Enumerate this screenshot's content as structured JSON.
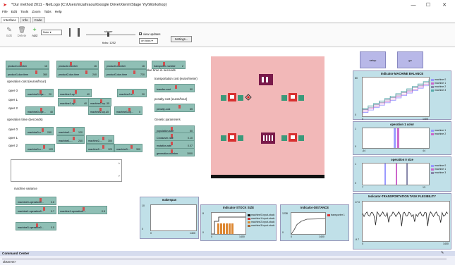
{
  "window": {
    "title": "*Our method 2011 - NetLogo {C:\\Users\\mzahraoui\\Google Drive\\Xterm\\Stage Yiy\\Workshop}",
    "min": "—",
    "max": "☐",
    "close": "✕"
  },
  "menu": [
    "File",
    "Edit",
    "Tools",
    "Zoom",
    "Tabs",
    "Help"
  ],
  "tabs": [
    "Interface",
    "Info",
    "Code"
  ],
  "toolbar": {
    "edit": "Edit",
    "delete": "Delete",
    "add": "Add",
    "widget_select": "Note",
    "speed_label": "slower",
    "ticks": "ticks: 1252",
    "view_updates": "view updates",
    "update_mode": "on ticks",
    "settings": "Settings..."
  },
  "left_sliders": {
    "row1": [
      {
        "name": "product1-number",
        "val": "16"
      },
      {
        "name": "product2-number",
        "val": "16"
      },
      {
        "name": "product3-number",
        "val": "16"
      },
      {
        "name": "transporter-number",
        "val": "2"
      }
    ],
    "row2": [
      {
        "name": "product1-due-time",
        "val": "360"
      },
      {
        "name": "product2-due-time",
        "val": "240"
      },
      {
        "name": "product3-due-time",
        "val": "720"
      }
    ]
  },
  "due_time_label": "due time in seconds",
  "op_cost": {
    "title": "operation cost (euros/hour)",
    "rows": [
      "oper 0",
      "oper 1",
      "oper 2"
    ],
    "s": [
      {
        "name": "machine0-ope...",
        "val": "20"
      },
      {
        "name": "machine1-op...",
        "val": "40"
      },
      {
        "name": "machine3-o...",
        "val": "20"
      },
      {
        "name": "machine1-op...",
        "val": "40"
      },
      {
        "name": "machine2-op...",
        "val": "35"
      },
      {
        "name": "machine0-ope...",
        "val": "40"
      },
      {
        "name": "machine2-op...",
        "val": "45"
      },
      {
        "name": "machine3-op...",
        "val": "0"
      }
    ]
  },
  "op_time": {
    "title": "operation time (seconds)",
    "rows": [
      "oper 0",
      "oper 1",
      "oper 2"
    ],
    "s": [
      {
        "name": "machine0-o...",
        "val": "240"
      },
      {
        "name": "machine1-...",
        "val": "120"
      },
      {
        "name": "machine1-...",
        "val": "240"
      },
      {
        "name": "machine2-...",
        "val": "300"
      },
      {
        "name": "machine0-o...",
        "val": "120"
      },
      {
        "name": "machine2-...",
        "val": "120"
      },
      {
        "name": "machine3-...",
        "val": "300"
      }
    ]
  },
  "transport": {
    "title": "transportation cost (euros/meter)",
    "s": {
      "name": "transfer-cost",
      "val": "50"
    }
  },
  "penalty": {
    "title": "penalty cost (euros/hour)",
    "s": {
      "name": "penalty-cost",
      "val": "65"
    }
  },
  "genetic": {
    "title": "Genetic parameters",
    "s": [
      {
        "name": "population-size",
        "val": "50"
      },
      {
        "name": "Crossover-rate",
        "val": "0.10"
      },
      {
        "name": "mutation-rate",
        "val": "0.07"
      },
      {
        "name": "generation-number",
        "val": "1000"
      }
    ]
  },
  "machine_variance": {
    "title": "machine variance",
    "s": [
      {
        "name": "machine0-operation0...",
        "val": "0.6"
      },
      {
        "name": "machine1-operation0...",
        "val": "0.7"
      },
      {
        "name": "machine1-operation1...",
        "val": "0.5"
      },
      {
        "name": "machine3-operation0...",
        "val": "0.5"
      }
    ]
  },
  "buttons": {
    "setup": "setup",
    "go": "go"
  },
  "plots": {
    "balance": {
      "title": "Indicator-MACHINE BALANCE",
      "ymax": "80",
      "y0": "0",
      "x0": "0",
      "xmax": "1400",
      "xlabel": "ticks",
      "ylabel": "machine\nnbr",
      "legend": [
        "machine 0",
        "machine 1",
        "machine 2",
        "machine 3"
      ],
      "colors": [
        "#9999ff",
        "#cc66cc",
        "#8888aa",
        "#55aaaa"
      ]
    },
    "color": {
      "title": "operation 1 color",
      "ymax": "1",
      "y0": "0",
      "x0": "-44",
      "xmax": "44",
      "legend": [
        "machine 1",
        "machine 2"
      ],
      "colors": [
        "#9999ff",
        "#cc66cc"
      ]
    },
    "size": {
      "title": "operation 0 size",
      "ymax": "1",
      "y0": "0",
      "x0": "7",
      "xmax": "13",
      "legend": [
        "machine 0",
        "machine 1",
        "machine 3"
      ],
      "colors": [
        "#9999ff",
        "#cc66cc",
        "#8888aa"
      ]
    },
    "flex": {
      "title": "Indicator-TRANSPORTATION TASK FLEXIBILITY",
      "ymax": "17.3",
      "y0": "-9.7",
      "x0": "0",
      "xmax": "1400"
    },
    "makespan": {
      "title": "makespan",
      "ymax": "10",
      "y0": "0",
      "x0": "0",
      "xmax": "1400"
    },
    "stock": {
      "title": "Indicator-STOCK SIZE",
      "ymax": "8",
      "y0": "0",
      "x0": "0",
      "xmax": "1400",
      "legend": [
        "machine0-input-stock",
        "machine1-input-stock",
        "machine2-input-stock",
        "machine3-input-stock"
      ],
      "colors": [
        "#111111",
        "#cc3333",
        "#dd8833",
        "#aa6633"
      ]
    },
    "distance": {
      "title": "Indicator-DISTANCE",
      "ymax": "1238",
      "y0": "0",
      "x0": "0",
      "xmax": "1400",
      "legend": [
        "transporter 1"
      ],
      "colors": [
        "#dd3333"
      ]
    }
  },
  "command_center": {
    "title": "Command Center",
    "prompt": "observer>"
  }
}
